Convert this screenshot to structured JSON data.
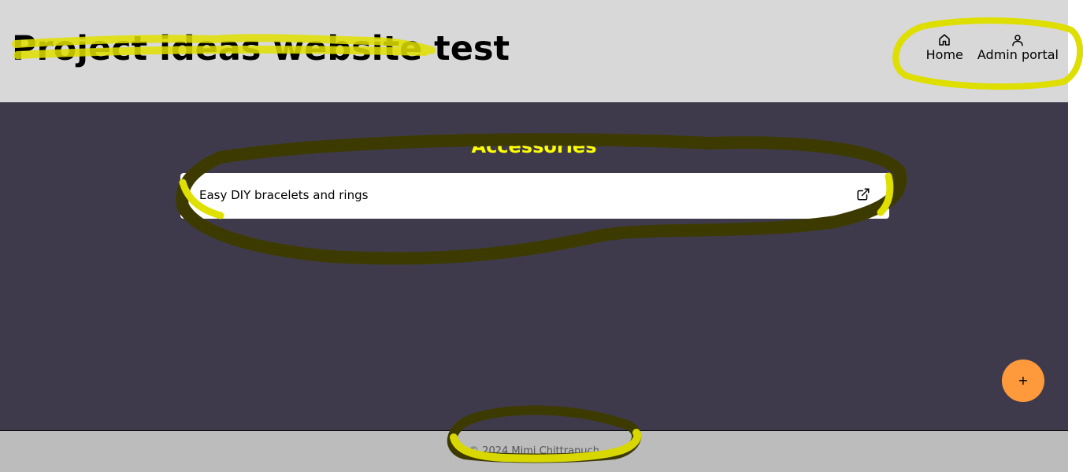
{
  "header": {
    "title": "Project ideas website test",
    "nav": [
      {
        "label": "Home",
        "icon": "home-icon"
      },
      {
        "label": "Admin portal",
        "icon": "user-icon"
      }
    ]
  },
  "main": {
    "section_title": "Accessories",
    "items": [
      {
        "label": "Easy DIY bracelets and rings",
        "icon": "external-link-icon"
      }
    ],
    "fab_label": "+"
  },
  "footer": {
    "copyright": "© 2024 Mimi Chittranuch"
  },
  "colors": {
    "header_bg": "#d8d8d8",
    "main_bg": "#3e3a4c",
    "section_title": "#ffff00",
    "fab": "#ff9a3c",
    "footer_bg": "#bcbcbc",
    "highlight_yellow": "#e0e000",
    "highlight_dark": "#3d3a00"
  }
}
